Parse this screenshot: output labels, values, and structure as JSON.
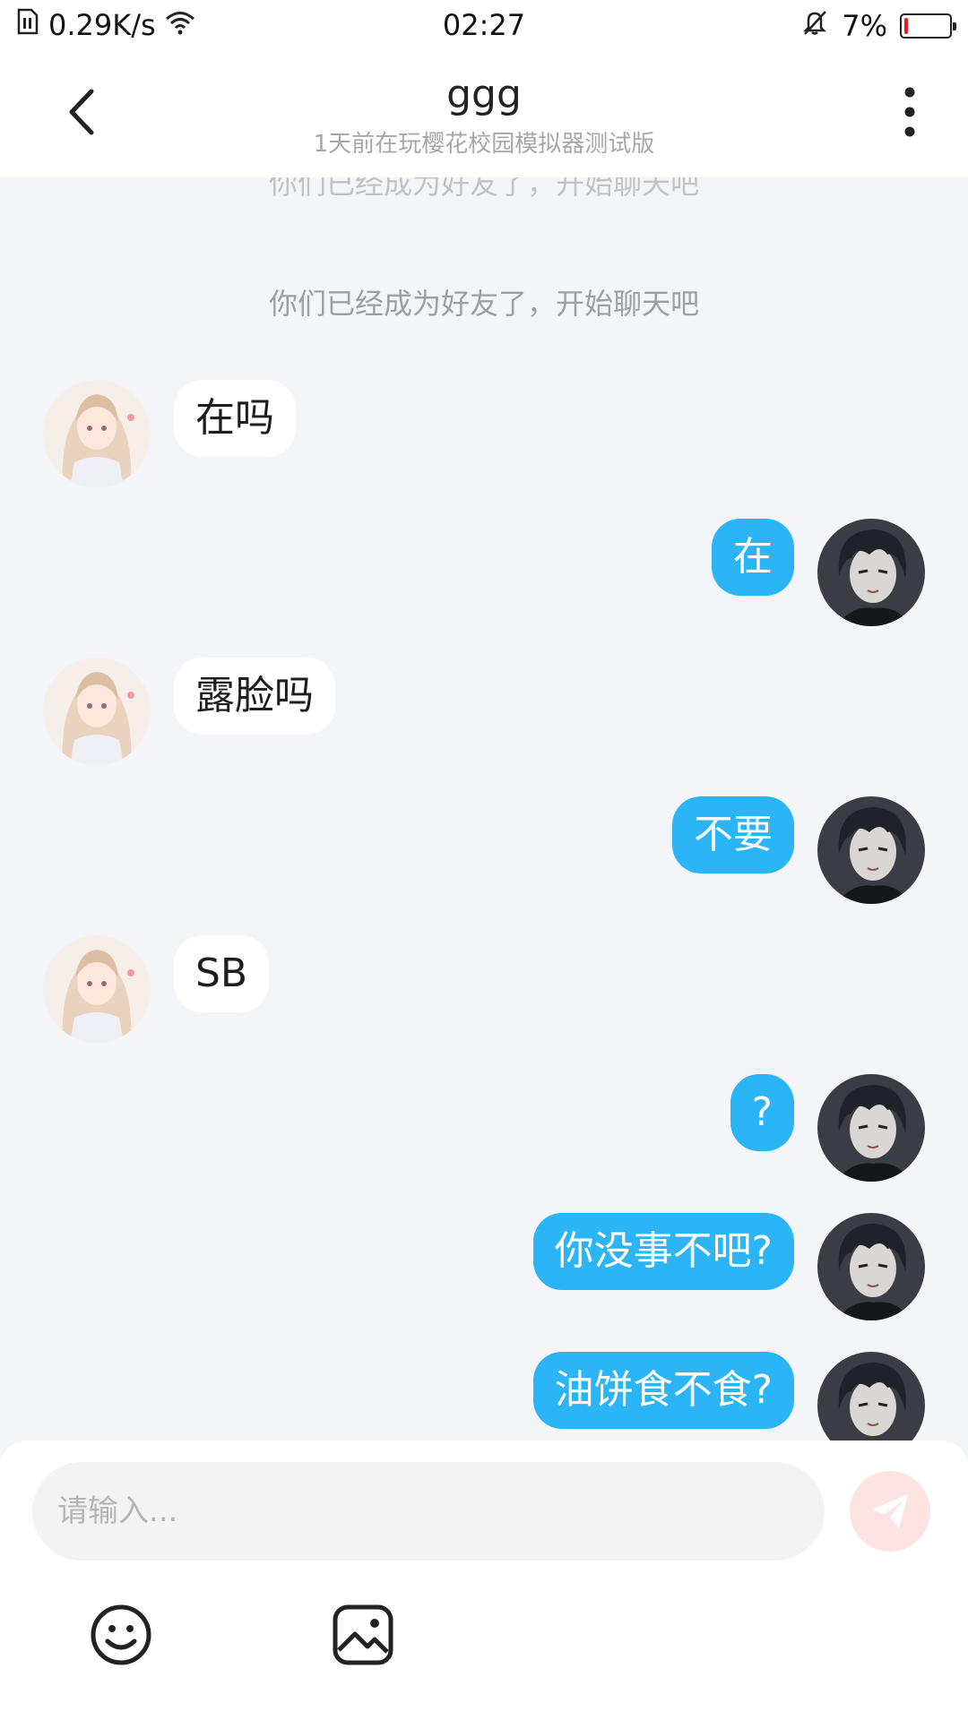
{
  "status_bar": {
    "network_speed": "0.29K/s",
    "time": "02:27",
    "battery_percent": "7%",
    "battery_level": 0.07,
    "icons": [
      "sim-icon",
      "wifi-icon",
      "mute-icon",
      "battery-icon"
    ]
  },
  "header": {
    "title": "ggg",
    "subtitle": "1天前在玩樱花校园模拟器测试版",
    "icons": [
      "back-arrow-icon",
      "more-vertical-icon"
    ]
  },
  "messages": {
    "system_faded": "你们已经成为好友了，开始聊天吧",
    "system": "你们已经成为好友了，开始聊天吧",
    "items": [
      {
        "from": "them",
        "text": "在吗"
      },
      {
        "from": "me",
        "text": "在"
      },
      {
        "from": "them",
        "text": "露脸吗"
      },
      {
        "from": "me",
        "text": "不要"
      },
      {
        "from": "them",
        "text": "SB"
      },
      {
        "from": "me",
        "text": "?"
      },
      {
        "from": "me",
        "text": "你没事不吧?"
      },
      {
        "from": "me",
        "text": "油饼食不食?"
      }
    ]
  },
  "composer": {
    "placeholder": "请输入...",
    "icons": [
      "send-icon",
      "emoji-icon",
      "image-icon"
    ]
  },
  "colors": {
    "outgoing_bubble": "#2bb5f7",
    "incoming_bubble": "#ffffff",
    "chat_background": "#f3f5f8",
    "send_button": "#fde4e2"
  }
}
